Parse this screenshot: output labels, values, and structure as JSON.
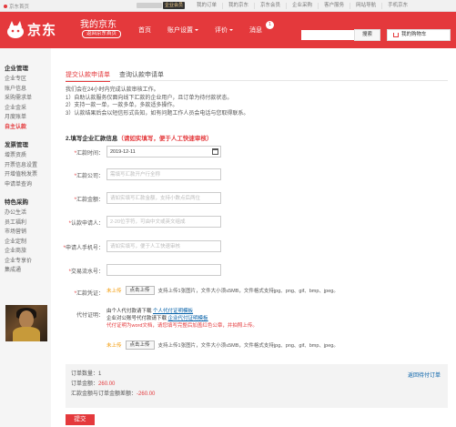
{
  "topbar": {
    "home": "京东首页",
    "vip_label": "企业会员",
    "links": [
      "我的订单",
      "我的京东",
      "京东会员",
      "企业采购",
      "客户服务",
      "网站导航",
      "手机京东"
    ]
  },
  "header": {
    "logo_text": "京东",
    "my_jd": "我的京东",
    "back_home": "返回京东首页",
    "nav": [
      {
        "label": "首页",
        "has_caret": false
      },
      {
        "label": "账户设置",
        "has_caret": true
      },
      {
        "label": "评价",
        "has_caret": true
      },
      {
        "label": "消息",
        "has_caret": false
      }
    ],
    "message_count": "1",
    "search_button": "搜索",
    "cart_label": "我的购物车",
    "brand_color": "#e4393c"
  },
  "sidebar": {
    "groups": [
      {
        "title": "企业管理",
        "items": [
          "企业专区",
          "账户信息",
          "采购需求单",
          "企业金采",
          "月度账单",
          "自主认款"
        ]
      },
      {
        "title": "发票管理",
        "items": [
          "增票资质",
          "开票信息设置",
          "开增值税发票",
          "申请单查询"
        ]
      },
      {
        "title": "特色采购",
        "items": [
          "办公生活",
          "员工福利",
          "市场营销",
          "企业定制",
          "企业商旅",
          "企业专享价",
          "集成通"
        ]
      }
    ],
    "active_item": "自主认款"
  },
  "tabs": [
    "提交认款申请单",
    "查询认款申请单"
  ],
  "notice": [
    "我们会在24小时内完成认款审核工作。",
    "1）自助认款服务仅面向线下汇款的企业用户，且订单为待付款状态。",
    "2）支持一款一单，一款多单，多款适多操作。",
    "3）认款结果后会以短信形式告知，如有问题工作人员会电话与您取得联系。"
  ],
  "section": {
    "title": "2.填写企业汇款信息",
    "hint": "（请如实填写，便于人工快速审核）"
  },
  "form": {
    "date_label": "汇款时间：",
    "date_value": "2019-12-11",
    "company_label": "汇款公司：",
    "company_placeholder": "需填写汇款开户行全称",
    "amount_label": "汇款金额：",
    "amount_placeholder": "请如实填写汇款金额，支持小数点后两位",
    "applicant_label": "认款申请人：",
    "applicant_placeholder": "2-20位字符，可由中文或英文组成",
    "phone_label": "申请人手机号：",
    "phone_placeholder": "请如实填写，便于人工快速审核",
    "serial_label": "交易流水号：",
    "voucher_label": "汇款凭证：",
    "proxy_label": "代付证明："
  },
  "upload": {
    "status": "未上传",
    "button": "点击上传",
    "hint": "支持上传1张图片，文件大小须≤5MB，文件格式支持jpg、png、gif、bmp、jpeg。"
  },
  "proxy": {
    "line1_prefix": "由个人代付款请下载",
    "line1_link": "个人代付证明模板",
    "line2_prefix": "企业对公账号代付款请下载",
    "line2_link": "企业代付证明模板",
    "warning": "代付证明为word文档，请您填写完整后加盖红色公章，并拍照上传。"
  },
  "summary": {
    "count_label": "订单数量：",
    "count_value": "1",
    "amount_label": "订单金额：",
    "amount_value": "260.00",
    "diff_label": "汇款金额与订单金额差额：",
    "diff_value": "-260.00",
    "return_link": "返回待付订单"
  },
  "submit": "提交"
}
